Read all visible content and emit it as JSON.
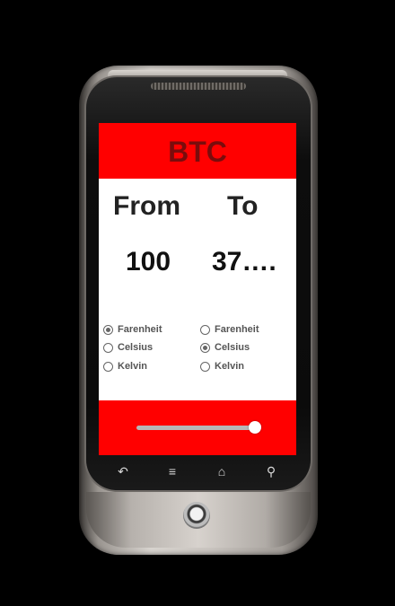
{
  "app": {
    "title": "BTC",
    "from_label": "From",
    "to_label": "To",
    "from_value": "100",
    "to_value": "37….",
    "from_units": [
      {
        "label": "Farenheit",
        "selected": true
      },
      {
        "label": "Celsius",
        "selected": false
      },
      {
        "label": "Kelvin",
        "selected": false
      }
    ],
    "to_units": [
      {
        "label": "Farenheit",
        "selected": false
      },
      {
        "label": "Celsius",
        "selected": true
      },
      {
        "label": "Kelvin",
        "selected": false
      }
    ],
    "slider_value_fraction": 1.0,
    "colors": {
      "bar": "#ff0000",
      "title": "#7a0c0c"
    }
  },
  "nav_keys": [
    "back-icon",
    "menu-icon",
    "home-icon",
    "search-icon"
  ]
}
